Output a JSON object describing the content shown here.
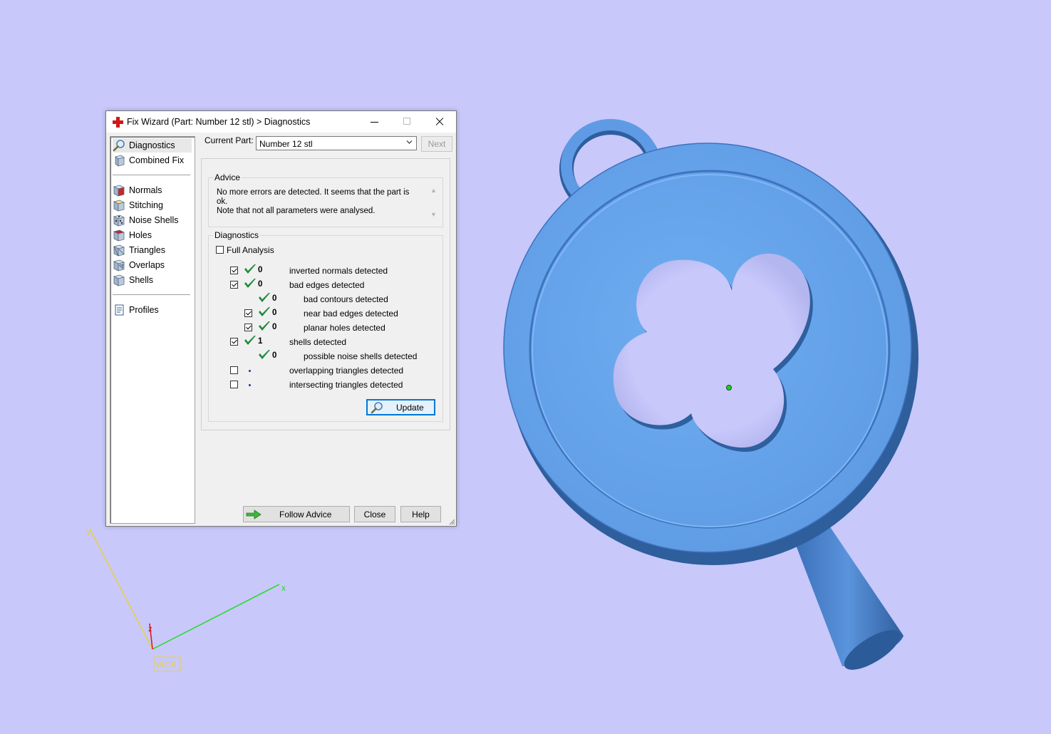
{
  "window": {
    "title": "Fix Wizard (Part: Number 12 stl) > Diagnostics",
    "icon": "red-cross-icon",
    "controls": [
      "minimize",
      "maximize",
      "close"
    ]
  },
  "sidebar": {
    "items": [
      {
        "label": "Diagnostics",
        "icon": "magnifier-icon",
        "selected": true
      },
      {
        "label": "Combined Fix",
        "icon": "combined-fix-cube-icon"
      },
      {
        "label": "Normals",
        "icon": "normals-cube-icon"
      },
      {
        "label": "Stitching",
        "icon": "stitching-cube-icon"
      },
      {
        "label": "Noise Shells",
        "icon": "noise-shells-cube-icon"
      },
      {
        "label": "Holes",
        "icon": "holes-cube-icon"
      },
      {
        "label": "Triangles",
        "icon": "triangles-cube-icon"
      },
      {
        "label": "Overlaps",
        "icon": "overlaps-cube-icon"
      },
      {
        "label": "Shells",
        "icon": "shells-cube-icon"
      },
      {
        "label": "Profiles",
        "icon": "document-icon"
      }
    ]
  },
  "current_part": {
    "label": "Current Part:",
    "value": "Number 12 stl",
    "next_label": "Next"
  },
  "advice": {
    "title": "Advice",
    "text": "No more errors are detected. It seems that the part is ok.\nNote that not all parameters were analysed."
  },
  "diagnostics": {
    "title": "Diagnostics",
    "full_analysis_label": "Full Analysis",
    "full_analysis_checked": false,
    "rows": [
      {
        "checkbox": true,
        "checked": true,
        "status": "ok",
        "count": "0",
        "label": "inverted normals detected",
        "indent": 0
      },
      {
        "checkbox": true,
        "checked": true,
        "status": "ok",
        "count": "0",
        "label": "bad edges detected",
        "indent": 0
      },
      {
        "checkbox": false,
        "checked": false,
        "status": "ok",
        "count": "0",
        "label": "bad contours detected",
        "indent": 1
      },
      {
        "checkbox": true,
        "checked": true,
        "status": "ok",
        "count": "0",
        "label": "near bad edges detected",
        "indent": 1
      },
      {
        "checkbox": true,
        "checked": true,
        "status": "ok",
        "count": "0",
        "label": "planar holes detected",
        "indent": 1
      },
      {
        "checkbox": true,
        "checked": true,
        "status": "ok",
        "count": "1",
        "label": "shells detected",
        "indent": 0
      },
      {
        "checkbox": false,
        "checked": false,
        "status": "ok",
        "count": "0",
        "label": "possible noise shells detected",
        "indent": 1
      },
      {
        "checkbox": true,
        "checked": false,
        "status": "none",
        "count": "",
        "label": "overlapping triangles detected",
        "indent": 0
      },
      {
        "checkbox": true,
        "checked": false,
        "status": "none",
        "count": "",
        "label": "intersecting triangles detected",
        "indent": 0
      }
    ],
    "update_label": "Update"
  },
  "footer": {
    "follow_advice_label": "Follow Advice",
    "close_label": "Close",
    "help_label": "Help"
  },
  "axes": {
    "x_label": "x",
    "y_label": "y",
    "z_label": "z",
    "wcs_label": "WCS",
    "x_color": "#22dd22",
    "y_color": "#e6d23c",
    "z_color": "#dd1111"
  },
  "model": {
    "color": "#6aa6ea",
    "shadow_color": "#2e5e9c"
  },
  "colors": {
    "background": "#c8c8fb",
    "check_green": "#1f8a3a"
  }
}
